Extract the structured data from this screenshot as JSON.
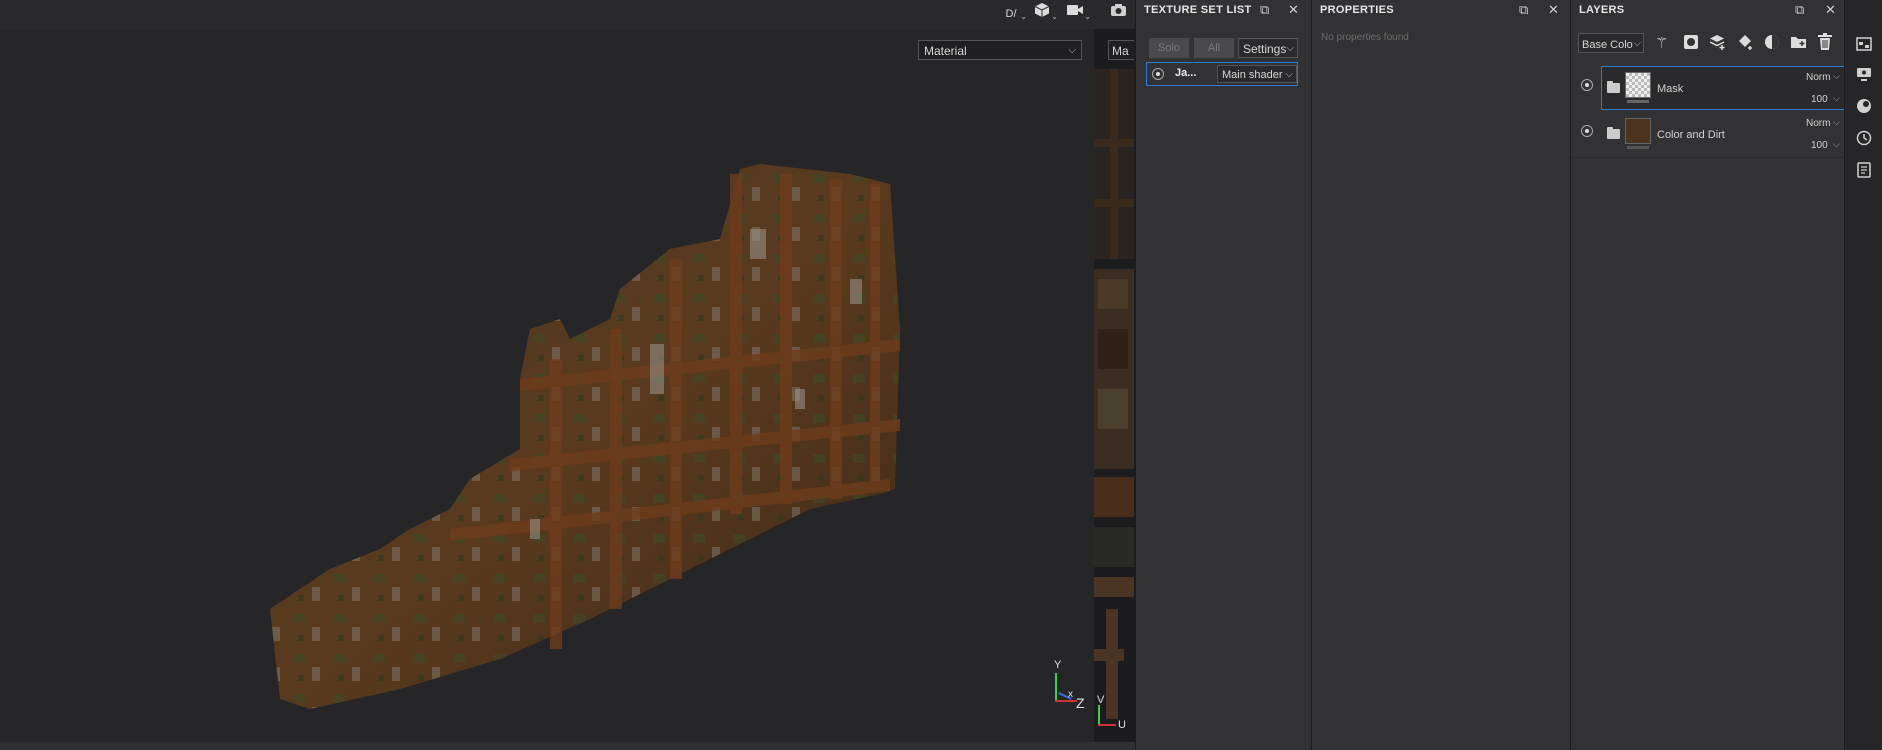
{
  "toolbar": {
    "icons": [
      "display-mode-icon",
      "cube-icon",
      "video-camera-icon",
      "screenshot-camera-icon"
    ],
    "display_mode_glyph": "D/"
  },
  "viewport3d": {
    "channel_select": "Material",
    "axis": {
      "y": "Y",
      "x": "x",
      "z": "Z"
    }
  },
  "viewport2d": {
    "channel_select": "Ma",
    "axis": {
      "v": "V",
      "u": "U"
    }
  },
  "texture_set_list": {
    "title": "TEXTURE SET LIST",
    "solo_label": "Solo",
    "all_label": "All",
    "settings_label": "Settings",
    "item_name": "Ja...",
    "shader": "Main shader"
  },
  "properties": {
    "title": "PROPERTIES",
    "empty_text": "No properties found"
  },
  "layers": {
    "title": "LAYERS",
    "channel": "Base Colo",
    "tool_icons": [
      "magic-wand-icon",
      "mask-add-icon",
      "layer-add-icon",
      "fill-layer-icon",
      "smart-material-icon",
      "folder-add-icon",
      "trash-icon"
    ],
    "items": [
      {
        "name": "Mask",
        "blend": "Norm",
        "opacity": "100",
        "selected": true
      },
      {
        "name": "Color and Dirt",
        "blend": "Norm",
        "opacity": "100",
        "selected": false
      }
    ]
  },
  "right_bar": {
    "icons": [
      "shelf-icon",
      "display-settings-icon",
      "viewer-icon",
      "history-icon",
      "log-icon"
    ]
  },
  "colors": {
    "accent": "#2a7fd4",
    "panel_bg": "#323234",
    "viewport_bg": "#262629"
  }
}
